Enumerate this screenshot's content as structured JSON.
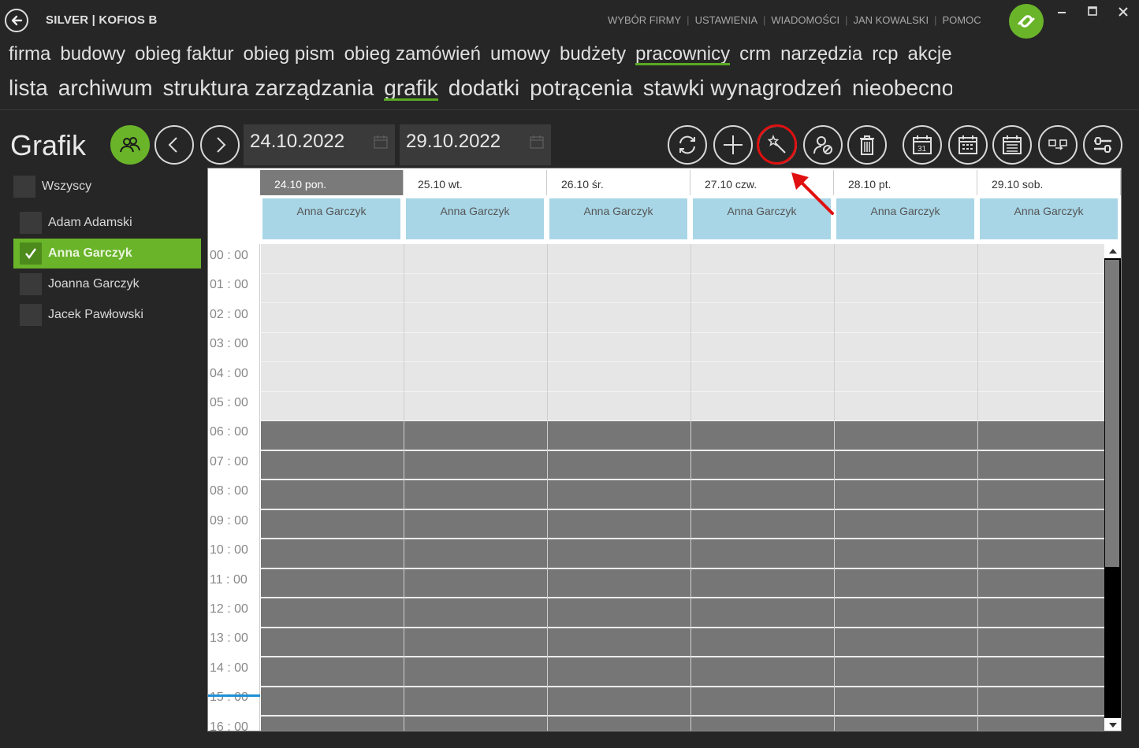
{
  "app": {
    "title": "SILVER | KOFIOS B"
  },
  "top_links": [
    "WYBÓR FIRMY",
    "USTAWIENIA",
    "WIADOMOŚCI",
    "JAN KOWALSKI",
    "POMOC"
  ],
  "menu_main": [
    "firma",
    "budowy",
    "obieg faktur",
    "obieg pism",
    "obieg zamówień",
    "umowy",
    "budżety",
    "pracownicy",
    "crm",
    "narzędzia",
    "rcp",
    "akcje"
  ],
  "menu_main_active": "pracownicy",
  "menu_sub": [
    "lista",
    "archiwum",
    "struktura zarządzania",
    "grafik",
    "dodatki",
    "potrącenia",
    "stawki wynagrodzeń",
    "nieobecności"
  ],
  "menu_sub_active": "grafik",
  "page": {
    "title": "Grafik"
  },
  "date_from": "24.10.2022",
  "date_to": "29.10.2022",
  "all_label": "Wszyscy",
  "employees": [
    {
      "name": "Adam Adamski",
      "selected": false
    },
    {
      "name": "Anna Garczyk",
      "selected": true
    },
    {
      "name": "Joanna  Garczyk",
      "selected": false
    },
    {
      "name": "Jacek  Pawłowski",
      "selected": false
    }
  ],
  "days": [
    {
      "label": "24.10 pon.",
      "employee": "Anna Garczyk",
      "today": true
    },
    {
      "label": "25.10 wt.",
      "employee": "Anna Garczyk",
      "today": false
    },
    {
      "label": "26.10 śr.",
      "employee": "Anna Garczyk",
      "today": false
    },
    {
      "label": "27.10 czw.",
      "employee": "Anna Garczyk",
      "today": false
    },
    {
      "label": "28.10 pt.",
      "employee": "Anna Garczyk",
      "today": false
    },
    {
      "label": "29.10 sob.",
      "employee": "Anna Garczyk",
      "today": false
    }
  ],
  "hours": [
    "00 : 00",
    "01 : 00",
    "02 : 00",
    "03 : 00",
    "04 : 00",
    "05 : 00",
    "06 : 00",
    "07 : 00",
    "08 : 00",
    "09 : 00",
    "10 : 00",
    "11 : 00",
    "12 : 00",
    "13 : 00",
    "14 : 00",
    "15 : 00",
    "16 : 00"
  ],
  "colors": {
    "accent": "#6ab42a",
    "today_header": "#7a7a7a",
    "employee_chip": "#a8d6e6",
    "working_hours": "#767676",
    "off_hours": "#e6e6e6",
    "current_time": "#1e90d6",
    "annotation": "#e01010"
  }
}
